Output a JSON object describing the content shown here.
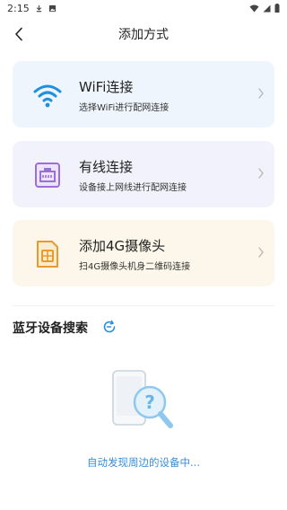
{
  "status_bar": {
    "time": "2:15",
    "icons": [
      "download-icon",
      "photo-icon",
      "wifi-icon",
      "signal-icon",
      "battery-icon"
    ]
  },
  "header": {
    "title": "添加方式",
    "back_icon": "chevron-left-icon"
  },
  "options": [
    {
      "title": "WiFi连接",
      "desc": "选择WiFi进行配网连接",
      "icon": "wifi-icon",
      "accent": "#1f8fe0"
    },
    {
      "title": "有线连接",
      "desc": "设备接上网线进行配网连接",
      "icon": "ethernet-icon",
      "accent": "#9c6fd6"
    },
    {
      "title": "添加4G摄像头",
      "desc": "扫4G摄像头机身二维码连接",
      "icon": "sim-card-icon",
      "accent": "#e89a2e"
    }
  ],
  "search": {
    "title": "蓝牙设备搜索",
    "refresh_icon": "refresh-icon",
    "status": "自动发现周边的设备中..."
  },
  "colors": {
    "link": "#3a8fd6",
    "wifi_card_bg": "#eff5fd",
    "wired_card_bg": "#f1f2fb",
    "g4_card_bg": "#fcf7ea"
  }
}
